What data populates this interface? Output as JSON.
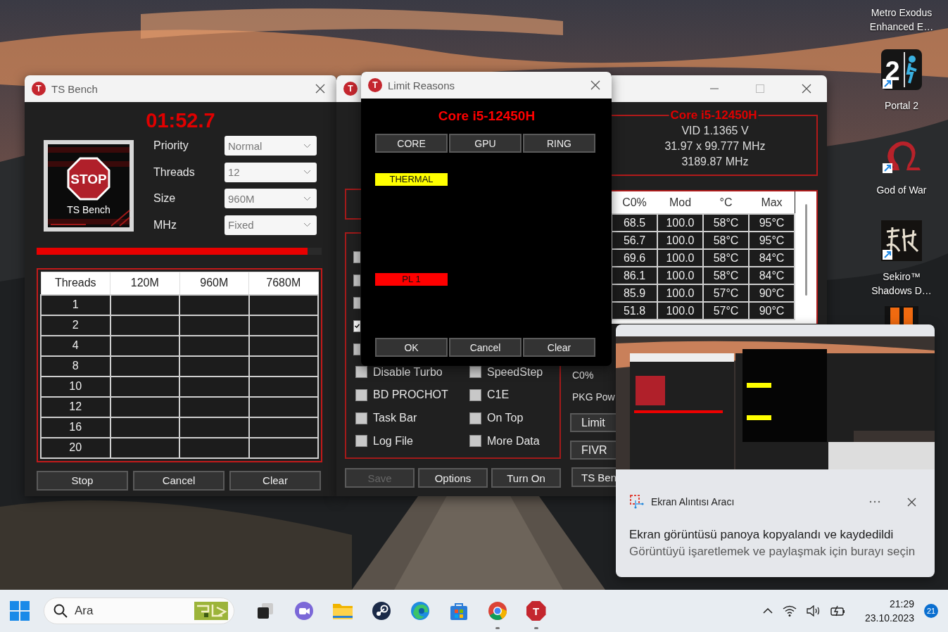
{
  "desktop_icons": [
    {
      "kind": "cut",
      "lines": [
        "Metro Exodus",
        "Enhanced E…"
      ]
    },
    {
      "kind": "portal",
      "glyph": "2",
      "lines": [
        "Portal 2"
      ]
    },
    {
      "kind": "omega",
      "lines": [
        "God of War"
      ]
    },
    {
      "kind": "brush",
      "lines": [
        "Sekiro™",
        "Shadows D…"
      ]
    },
    {
      "kind": "orange"
    }
  ],
  "ts_bench": {
    "icon_letter": "T",
    "title": "TS Bench",
    "timer": "01:52.7",
    "stop_sign": "STOP",
    "logo_caption": "TS Bench",
    "settings": [
      {
        "label": "Priority",
        "value": "Normal"
      },
      {
        "label": "Threads",
        "value": "12"
      },
      {
        "label": "Size",
        "value": "960M"
      },
      {
        "label": "MHz",
        "value": "Fixed"
      }
    ],
    "progress": {
      "level": 0.95
    },
    "table": {
      "columns": [
        "Threads",
        "120M",
        "960M",
        "7680M"
      ],
      "rows": [
        "1",
        "2",
        "4",
        "8",
        "10",
        "12",
        "16",
        "20"
      ]
    },
    "buttons": [
      "Stop",
      "Cancel",
      "Clear"
    ]
  },
  "main_window": {
    "icon_letter": "T",
    "cpu": "Core i5-12450H",
    "vid": "VID  1.1365 V",
    "multiplier": "31.97 x 99.777 MHz",
    "speed": "3189.87 MHz",
    "table": {
      "columns": [
        "C0%",
        "Mod",
        "°C",
        "Max"
      ],
      "rows": [
        [
          "68.5",
          "100.0",
          "58°C",
          "95°C"
        ],
        [
          "56.7",
          "100.0",
          "58°C",
          "95°C"
        ],
        [
          "69.6",
          "100.0",
          "58°C",
          "84°C"
        ],
        [
          "86.1",
          "100.0",
          "58°C",
          "84°C"
        ],
        [
          "85.9",
          "100.0",
          "57°C",
          "90°C"
        ],
        [
          "51.8",
          "100.0",
          "57°C",
          "90°C"
        ]
      ]
    },
    "hidden_checkboxes": [
      {
        "checked": false
      },
      {
        "checked": false
      },
      {
        "checked": false
      },
      {
        "checked": true
      },
      {
        "checked": false
      }
    ],
    "options": [
      {
        "label": "Disable Turbo",
        "checked": false
      },
      {
        "label": "SpeedStep",
        "checked": false
      },
      {
        "label": "BD PROCHOT",
        "checked": false
      },
      {
        "label": "C1E",
        "checked": false
      },
      {
        "label": "Task Bar",
        "checked": false
      },
      {
        "label": "On Top",
        "checked": false
      },
      {
        "label": "Log File",
        "checked": false
      },
      {
        "label": "More Data",
        "checked": false
      }
    ],
    "side_labels": [
      "C0%",
      "PKG Pow"
    ],
    "side_buttons": [
      "Limit",
      "FIVR"
    ],
    "buttons": [
      {
        "label": "Save",
        "disabled": true
      },
      {
        "label": "Options",
        "disabled": false
      },
      {
        "label": "Turn On",
        "disabled": false
      }
    ],
    "side_bottom_button": "TS Ben"
  },
  "limit_reasons": {
    "icon_letter": "T",
    "title": "Limit Reasons",
    "cpu": "Core i5-12450H",
    "tabs": [
      "CORE",
      "GPU",
      "RING"
    ],
    "flags": [
      {
        "label": "THERMAL",
        "color": "#ffff00"
      },
      {
        "label": "PL 1",
        "color": "#ff0000"
      }
    ],
    "buttons": [
      "OK",
      "Cancel",
      "Clear"
    ]
  },
  "notification": {
    "app": "Ekran Alıntısı Aracı",
    "title": "Ekran görüntüsü panoya kopyalandı ve kaydedildi",
    "body": "Görüntüyü işaretlemek ve paylaşmak için burayı seçin"
  },
  "taskbar": {
    "search_placeholder": "Ara",
    "apps": [
      {
        "kind": "taskview",
        "running": false
      },
      {
        "kind": "meet",
        "running": false
      },
      {
        "kind": "folder",
        "running": false
      },
      {
        "kind": "steam",
        "running": false
      },
      {
        "kind": "edge",
        "running": false
      },
      {
        "kind": "store",
        "running": false
      },
      {
        "kind": "chrome",
        "running": true
      },
      {
        "kind": "throttle",
        "running": true,
        "letter": "T"
      }
    ],
    "time": "21:29",
    "date": "23.10.2023",
    "badge": "21"
  }
}
